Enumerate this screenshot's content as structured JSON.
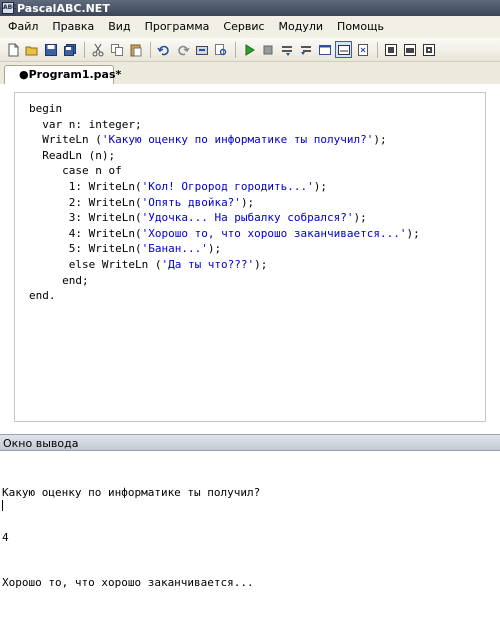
{
  "window": {
    "title": "PascalABC.NET",
    "icon_text": "ABC"
  },
  "menu": [
    "Файл",
    "Правка",
    "Вид",
    "Программа",
    "Сервис",
    "Модули",
    "Помощь"
  ],
  "toolbar": {
    "icons": [
      "new-file-icon",
      "open-folder-icon",
      "save-icon",
      "save-all-icon",
      "cut-icon",
      "copy-icon",
      "paste-icon",
      "undo-icon",
      "redo-icon",
      "compile-icon",
      "search-icon",
      "run-icon",
      "stop-icon",
      "step-over-icon",
      "step-into-icon",
      "form-designer-icon",
      "output-window-icon",
      "debug-window-icon",
      "module-icon-1",
      "module-icon-2",
      "module-icon-3"
    ]
  },
  "tabs": [
    {
      "label": "●Program1.pas*",
      "active": true
    }
  ],
  "code_lines": [
    "begin",
    "  var n: integer;",
    "  WriteLn ('Какую оценку по информатике ты получил?');",
    "  ReadLn (n);",
    "     case n of",
    "      1: WriteLn('Кол! Огрород городить...');",
    "      2: WriteLn('Опять двойка?');",
    "      3: WriteLn('Удочка... На рыбалку собрался?');",
    "      4: WriteLn('Хорошо то, что хорошо заканчивается...');",
    "      5: WriteLn('Банан...');",
    "      else WriteLn ('Да ты что???');",
    "     end;",
    "end."
  ],
  "output": {
    "title": "Окно вывода",
    "lines": [
      "Какую оценку по информатике ты получил?",
      "4",
      "Хорошо то, что хорошо заканчивается..."
    ]
  },
  "colors": {
    "string": "#0000c8",
    "titlebar": "#3b4658",
    "menubar": "#f1efe6"
  }
}
